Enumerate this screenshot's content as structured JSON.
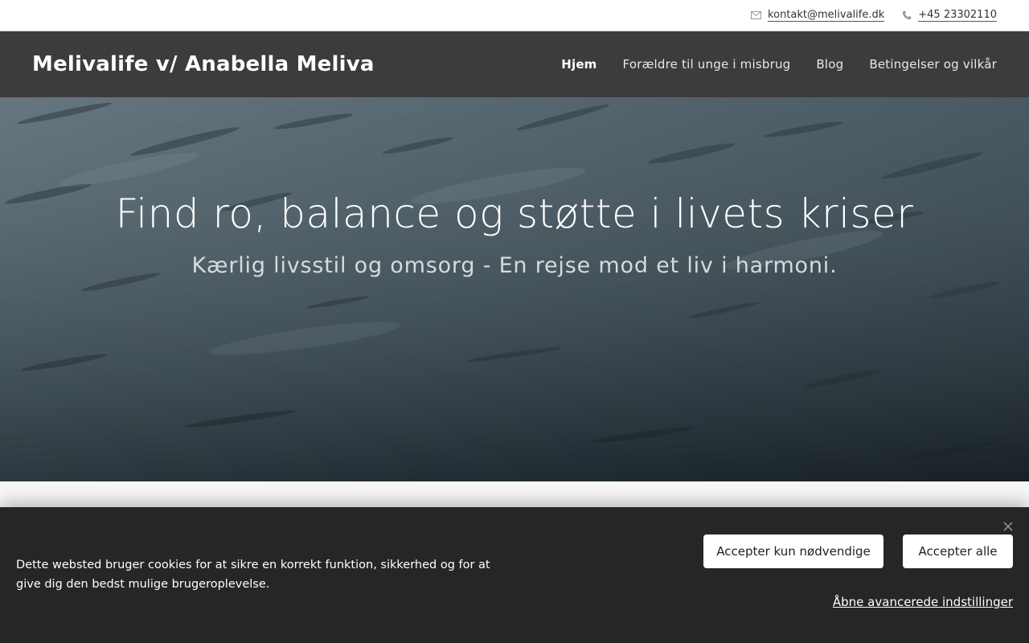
{
  "topbar": {
    "email": "kontakt@melivalife.dk",
    "phone": "+45 23302110",
    "email_icon": "mail-icon",
    "phone_icon": "phone-icon"
  },
  "header": {
    "logo": "Melivalife v/ Anabella Meliva",
    "nav": [
      {
        "label": "Hjem",
        "active": true
      },
      {
        "label": "Forældre til unge i misbrug",
        "active": false
      },
      {
        "label": "Blog",
        "active": false
      },
      {
        "label": "Betingelser og vilkår",
        "active": false
      }
    ]
  },
  "hero": {
    "title": "Find ro, balance og støtte i livets kriser",
    "subtitle": "Kærlig livsstil og omsorg - En rejse mod et liv i harmoni."
  },
  "cookie": {
    "text": "Dette websted bruger cookies for at sikre en korrekt funktion, sikkerhed og for at give dig den bedst mulige brugeroplevelse.",
    "accept_necessary": "Accepter kun nødvendige",
    "accept_all": "Accepter alle",
    "advanced": "Åbne avancerede indstillinger",
    "close_icon": "close-icon"
  },
  "colors": {
    "header_bg": "#3c3c3c",
    "cookie_bg": "#262626",
    "hero_tone": "#3a4b54"
  }
}
